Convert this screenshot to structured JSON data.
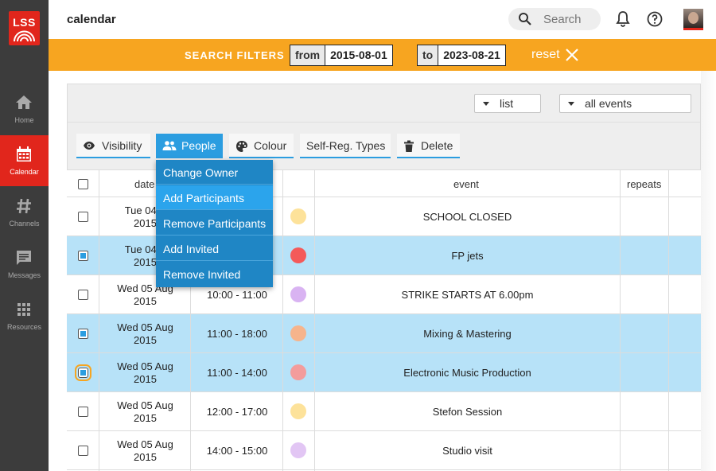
{
  "app": {
    "logo_text": "LSS",
    "page_title": "calendar"
  },
  "colors": {
    "brand": "#e1261c",
    "filter_bar": "#f7a520",
    "accent_blue": "#2b9de0",
    "selected_row": "#b7e2f8"
  },
  "sidebar": {
    "items": [
      {
        "label": "Home",
        "icon": "home-icon"
      },
      {
        "label": "Calendar",
        "icon": "calendar-icon",
        "active": true
      },
      {
        "label": "Channels",
        "icon": "hash-icon"
      },
      {
        "label": "Messages",
        "icon": "chat-icon"
      },
      {
        "label": "Resources",
        "icon": "grid-icon"
      }
    ]
  },
  "header": {
    "search_placeholder": "Search"
  },
  "filters": {
    "label": "SEARCH FILTERS",
    "from_label": "from",
    "from_value": "2015-08-01",
    "to_label": "to",
    "to_value": "2023-08-21",
    "reset_label": "reset"
  },
  "controls": {
    "view_select": "list",
    "events_select": "all events"
  },
  "toolbar": {
    "visibility": "Visibility",
    "people": "People",
    "colour": "Colour",
    "selfreg": "Self-Reg. Types",
    "delete": "Delete"
  },
  "people_menu": {
    "items": [
      "Change Owner",
      "Add Participants",
      "Remove Participants",
      "Add Invited",
      "Remove Invited"
    ],
    "hovered": "Add Participants"
  },
  "table": {
    "columns": {
      "date": "date",
      "event": "event",
      "repeats": "repeats"
    },
    "rows": [
      {
        "date1": "Tue 04 A",
        "date2": "2015",
        "time": "",
        "event": "SCHOOL CLOSED",
        "color": "#fde29a",
        "selected": false
      },
      {
        "date1": "Tue 04 A",
        "date2": "2015",
        "time": "",
        "event": "FP jets",
        "color": "#f45a5a",
        "selected": true
      },
      {
        "date1": "Wed 05 Aug",
        "date2": "2015",
        "time": "10:00 - 11:00",
        "event": "STRIKE STARTS AT 6.00pm",
        "color": "#d9b3f2",
        "selected": false
      },
      {
        "date1": "Wed 05 Aug",
        "date2": "2015",
        "time": "11:00 - 18:00",
        "event": "Mixing & Mastering",
        "color": "#f6b48c",
        "selected": true
      },
      {
        "date1": "Wed 05 Aug",
        "date2": "2015",
        "time": "11:00 - 14:00",
        "event": "Electronic Music Production",
        "color": "#f39c9c",
        "selected": true,
        "focused": true
      },
      {
        "date1": "Wed 05 Aug",
        "date2": "2015",
        "time": "12:00 - 17:00",
        "event": "Stefon Session",
        "color": "#fde29a",
        "selected": false
      },
      {
        "date1": "Wed 05 Aug",
        "date2": "2015",
        "time": "14:00 - 15:00",
        "event": "Studio visit",
        "color": "#e2c6f4",
        "selected": false
      }
    ]
  }
}
